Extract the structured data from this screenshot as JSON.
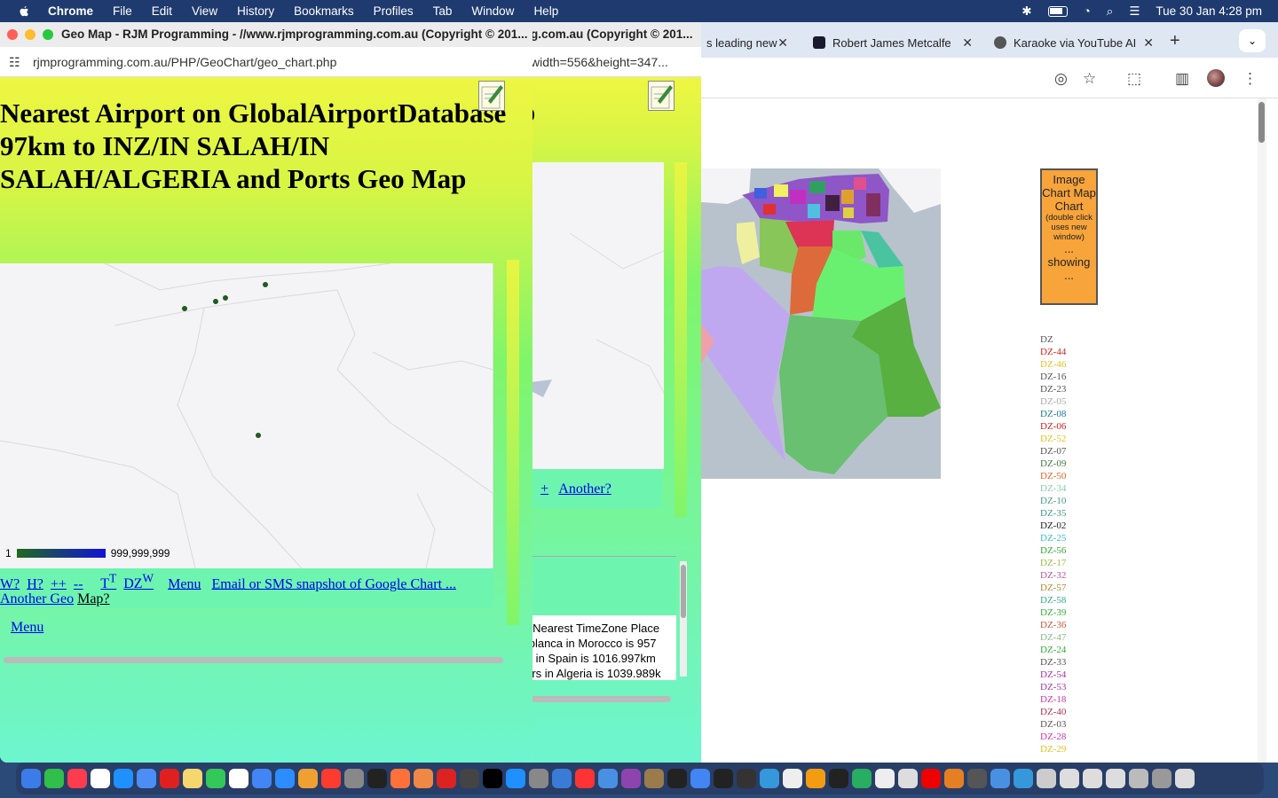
{
  "menubar": {
    "app": "Chrome",
    "items": [
      "File",
      "Edit",
      "View",
      "History",
      "Bookmarks",
      "Profiles",
      "Tab",
      "Window",
      "Help"
    ],
    "datetime": "Tue 30 Jan  4:28 pm"
  },
  "back_window": {
    "tabs": [
      {
        "label": "s leading new"
      },
      {
        "label": "Robert James Metcalfe"
      },
      {
        "label": "Karaoke via YouTube AI"
      }
    ],
    "image_chart_button": {
      "line1": "Image Chart Map Chart",
      "line2": "(double click uses new window)",
      "line3": "...",
      "line4": "showing",
      "line5": "..."
    },
    "region_codes": [
      {
        "code": "DZ",
        "color": "#555555"
      },
      {
        "code": "DZ-44",
        "color": "#cc2222"
      },
      {
        "code": "DZ-46",
        "color": "#e0c020"
      },
      {
        "code": "DZ-16",
        "color": "#555555"
      },
      {
        "code": "DZ-23",
        "color": "#555555"
      },
      {
        "code": "DZ-05",
        "color": "#aaaaaa"
      },
      {
        "code": "DZ-08",
        "color": "#227799"
      },
      {
        "code": "DZ-06",
        "color": "#cc2222"
      },
      {
        "code": "DZ-52",
        "color": "#e0c020"
      },
      {
        "code": "DZ-07",
        "color": "#555555"
      },
      {
        "code": "DZ-09",
        "color": "#447744"
      },
      {
        "code": "DZ-50",
        "color": "#dd6622"
      },
      {
        "code": "DZ-34",
        "color": "#88ccaa"
      },
      {
        "code": "DZ-10",
        "color": "#449988"
      },
      {
        "code": "DZ-35",
        "color": "#449988"
      },
      {
        "code": "DZ-02",
        "color": "#222222"
      },
      {
        "code": "DZ-25",
        "color": "#33bbcc"
      },
      {
        "code": "DZ-56",
        "color": "#33aa33"
      },
      {
        "code": "DZ-17",
        "color": "#99bb44"
      },
      {
        "code": "DZ-32",
        "color": "#bb5599"
      },
      {
        "code": "DZ-57",
        "color": "#aa8833"
      },
      {
        "code": "DZ-58",
        "color": "#33aa88"
      },
      {
        "code": "DZ-39",
        "color": "#33aa33"
      },
      {
        "code": "DZ-36",
        "color": "#cc5533"
      },
      {
        "code": "DZ-47",
        "color": "#88bb88"
      },
      {
        "code": "DZ-24",
        "color": "#33aa33"
      },
      {
        "code": "DZ-33",
        "color": "#555555"
      },
      {
        "code": "DZ-54",
        "color": "#aa33aa"
      },
      {
        "code": "DZ-53",
        "color": "#aa33aa"
      },
      {
        "code": "DZ-18",
        "color": "#cc33aa"
      },
      {
        "code": "DZ-40",
        "color": "#aa3355"
      },
      {
        "code": "DZ-03",
        "color": "#555555"
      },
      {
        "code": "DZ-28",
        "color": "#cc33aa"
      },
      {
        "code": "DZ-29",
        "color": "#e0c020"
      }
    ]
  },
  "middle_window": {
    "title": "g.com.au (Copyright © 201...",
    "url": "width=556&height=347...",
    "letter": "p",
    "link_w": "W",
    "link_plus": "+",
    "link_another": "Another?",
    "nearest_text": [
      "ee Nearest TimeZone Place",
      "sablanca in Morocco is 957",
      "uta in Spain is 1016.997km",
      "giers in Algeria is 1039.989k"
    ]
  },
  "front_window": {
    "title": "Geo Map - RJM Programming - //www.rjmprogramming.com.au (Copyright © 201...",
    "url": "rjmprogramming.com.au/PHP/GeoChart/geo_chart.php",
    "heading": "Nearest Airport on GlobalAirportDatabase 97km to INZ/IN SALAH/IN SALAH/ALGERIA and Ports Geo Map",
    "legend_min": "1",
    "legend_max": "999,999,999",
    "links": [
      "W?",
      "H?",
      "++",
      "--",
      "T",
      "DZ",
      "Menu",
      "Email or SMS snapshot of Google Chart ...",
      "Another Geo",
      "Map?"
    ],
    "link_tt_sup": "T",
    "link_dz_sup": "W",
    "menu_link": "Menu"
  }
}
